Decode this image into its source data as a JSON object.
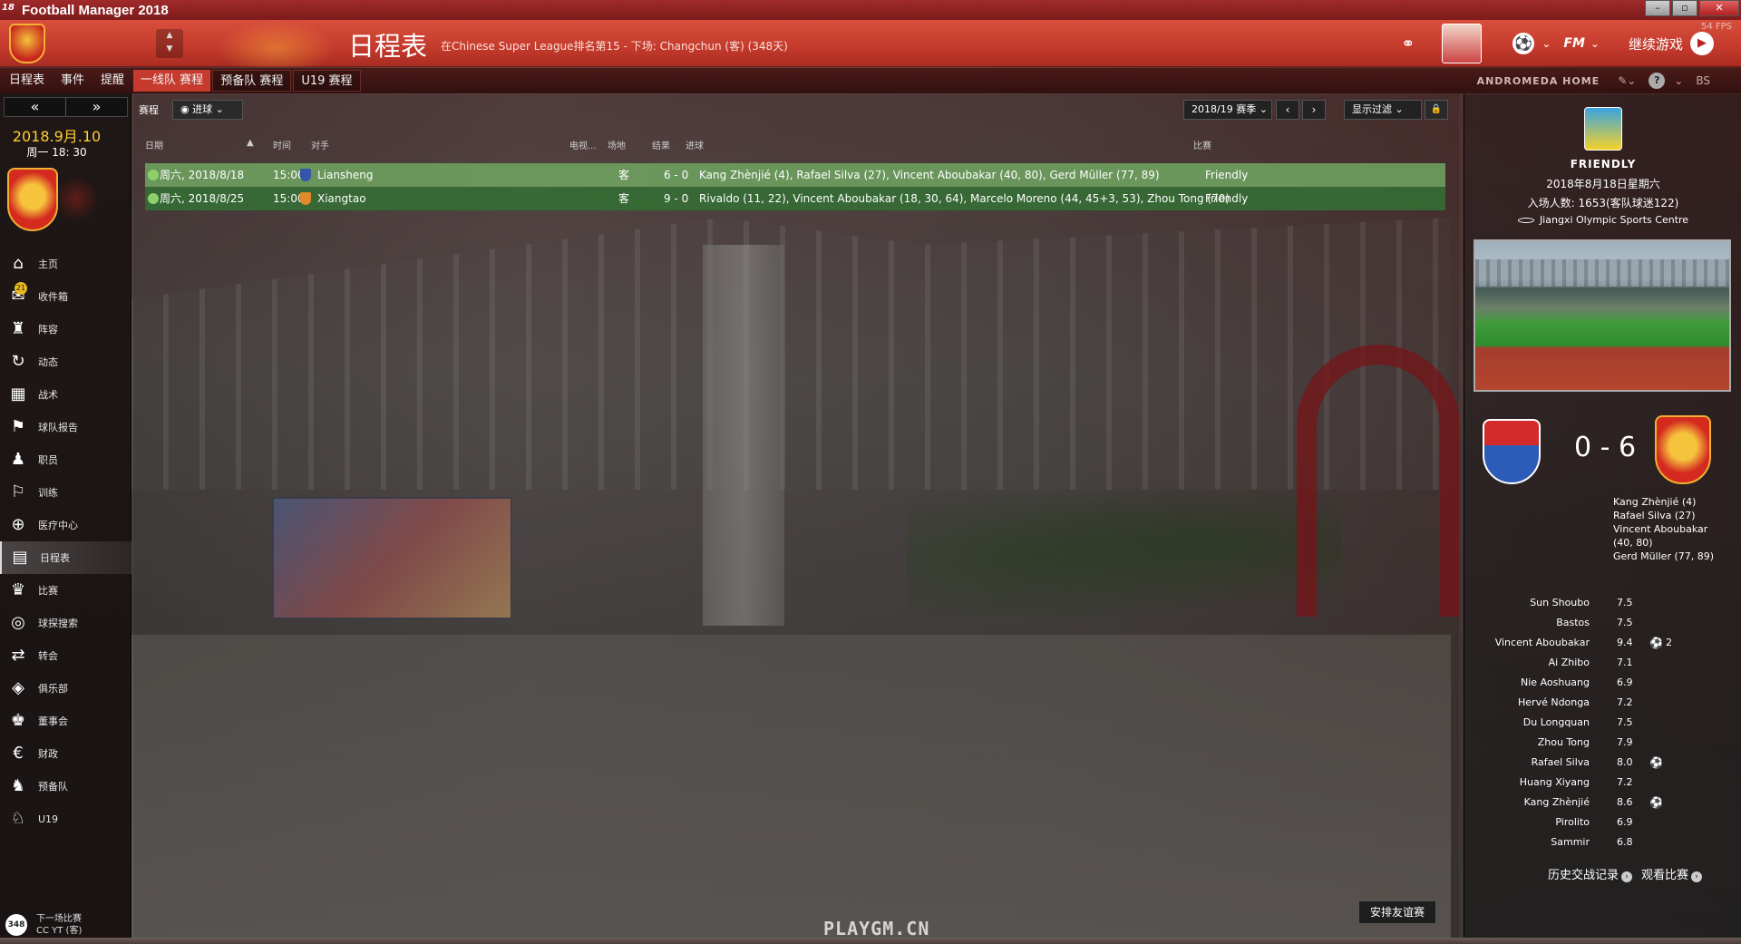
{
  "window": {
    "icon_text": "18",
    "title": "Football Manager 2018",
    "controls": [
      "–",
      "▫",
      "✕"
    ]
  },
  "header": {
    "title": "日程表",
    "subtitle": "在Chinese Super League排名第15 - 下场: Changchun (客) (348天)",
    "continue_label": "继续游戏",
    "fm_label": "FM",
    "fps": "54 FPS"
  },
  "tabs": {
    "main": [
      {
        "label": "日程表"
      },
      {
        "label": "事件"
      },
      {
        "label": "提醒"
      }
    ],
    "sub": [
      {
        "label": "一线队 赛程",
        "active": true
      },
      {
        "label": "预备队 赛程"
      },
      {
        "label": "U19 赛程"
      }
    ],
    "right_label": "ANDROMEDA HOME"
  },
  "sidebar": {
    "date": "2018.9月.10",
    "time": "周一 18: 30",
    "items": [
      {
        "label": "主页",
        "icon": "home-icon",
        "glyph": "⌂"
      },
      {
        "label": "收件箱",
        "icon": "inbox-icon",
        "glyph": "✉",
        "badge": "21"
      },
      {
        "label": "阵容",
        "icon": "squad-icon",
        "glyph": "♜"
      },
      {
        "label": "动态",
        "icon": "dynamics-icon",
        "glyph": "↻"
      },
      {
        "label": "战术",
        "icon": "tactics-icon",
        "glyph": "▦"
      },
      {
        "label": "球队报告",
        "icon": "team-report-icon",
        "glyph": "⚑"
      },
      {
        "label": "职员",
        "icon": "staff-icon",
        "glyph": "♟"
      },
      {
        "label": "训练",
        "icon": "training-icon",
        "glyph": "⚐"
      },
      {
        "label": "医疗中心",
        "icon": "medical-icon",
        "glyph": "⊕"
      },
      {
        "label": "日程表",
        "icon": "schedule-icon",
        "glyph": "▤",
        "active": true
      },
      {
        "label": "比赛",
        "icon": "trophy-icon",
        "glyph": "♛"
      },
      {
        "label": "球探搜索",
        "icon": "binoculars-icon",
        "glyph": "◎"
      },
      {
        "label": "转会",
        "icon": "transfer-icon",
        "glyph": "⇄"
      },
      {
        "label": "俱乐部",
        "icon": "club-icon",
        "glyph": "◈"
      },
      {
        "label": "董事会",
        "icon": "board-icon",
        "glyph": "♚"
      },
      {
        "label": "财政",
        "icon": "finance-icon",
        "glyph": "€"
      },
      {
        "label": "预备队",
        "icon": "reserves-icon",
        "glyph": "♞"
      },
      {
        "label": "U19",
        "icon": "u19-icon",
        "glyph": "♘"
      }
    ],
    "next_match": {
      "days": "348",
      "label": "下一场比赛",
      "opponent": "CC YT (客)"
    }
  },
  "toolbar": {
    "label": "赛程",
    "goals_filter": "进球",
    "season": "2018/19 赛季",
    "filter_label": "显示过滤"
  },
  "table": {
    "headers": {
      "date": "日期",
      "time": "时间",
      "opponent": "对手",
      "tv": "电视...",
      "venue": "场地",
      "result": "结果",
      "goals": "进球",
      "competition": "比赛"
    },
    "rows": [
      {
        "date": "周六, 2018/8/18",
        "time": "15:00",
        "opponent": "Liansheng",
        "venue": "客",
        "result": "6 - 0",
        "goals": "Kang Zhènjié (4), Rafael Silva (27), Vincent Aboubakar (40, 80), Gerd Müller (77, 89)",
        "competition": "Friendly",
        "crest_color": "#3355aa"
      },
      {
        "date": "周六, 2018/8/25",
        "time": "15:00",
        "opponent": "Xiangtao",
        "venue": "客",
        "result": "9 - 0",
        "goals": "Rivaldo (11, 22), Vincent Aboubakar (18, 30, 64), Marcelo Moreno (44, 45+3, 53), Zhou Tong (70)",
        "competition": "Friendly",
        "crest_color": "#e08a2a"
      }
    ]
  },
  "arrange_friendly_label": "安排友谊赛",
  "match_panel": {
    "competition": "FRIENDLY",
    "date": "2018年8月18日星期六",
    "attendance": "入场人数: 1653(客队球迷122)",
    "venue": "Jiangxi Olympic Sports Centre",
    "score": "0 - 6",
    "scorers": [
      "Kang Zhènjié (4)",
      "Rafael Silva (27)",
      "Vincent Aboubakar",
      "(40, 80)",
      "Gerd Müller (77, 89)"
    ],
    "ratings": [
      {
        "name": "Sun Shoubo",
        "rating": "7.5"
      },
      {
        "name": "Bastos",
        "rating": "7.5"
      },
      {
        "name": "Vincent Aboubakar",
        "rating": "9.4",
        "goals": "2"
      },
      {
        "name": "Ai Zhibo",
        "rating": "7.1"
      },
      {
        "name": "Nie Aoshuang",
        "rating": "6.9"
      },
      {
        "name": "Hervé Ndonga",
        "rating": "7.2"
      },
      {
        "name": "Du Longquan",
        "rating": "7.5"
      },
      {
        "name": "Zhou Tong",
        "rating": "7.9"
      },
      {
        "name": "Rafael Silva",
        "rating": "8.0",
        "goals": ""
      },
      {
        "name": "Huang Xiyang",
        "rating": "7.2"
      },
      {
        "name": "Kang Zhènjié",
        "rating": "8.6",
        "goals": ""
      },
      {
        "name": "Pirolito",
        "rating": "6.9"
      },
      {
        "name": "Sammir",
        "rating": "6.8"
      }
    ],
    "links": [
      "历史交战记录",
      "观看比赛"
    ]
  },
  "watermark": "PLAYGM.CN"
}
